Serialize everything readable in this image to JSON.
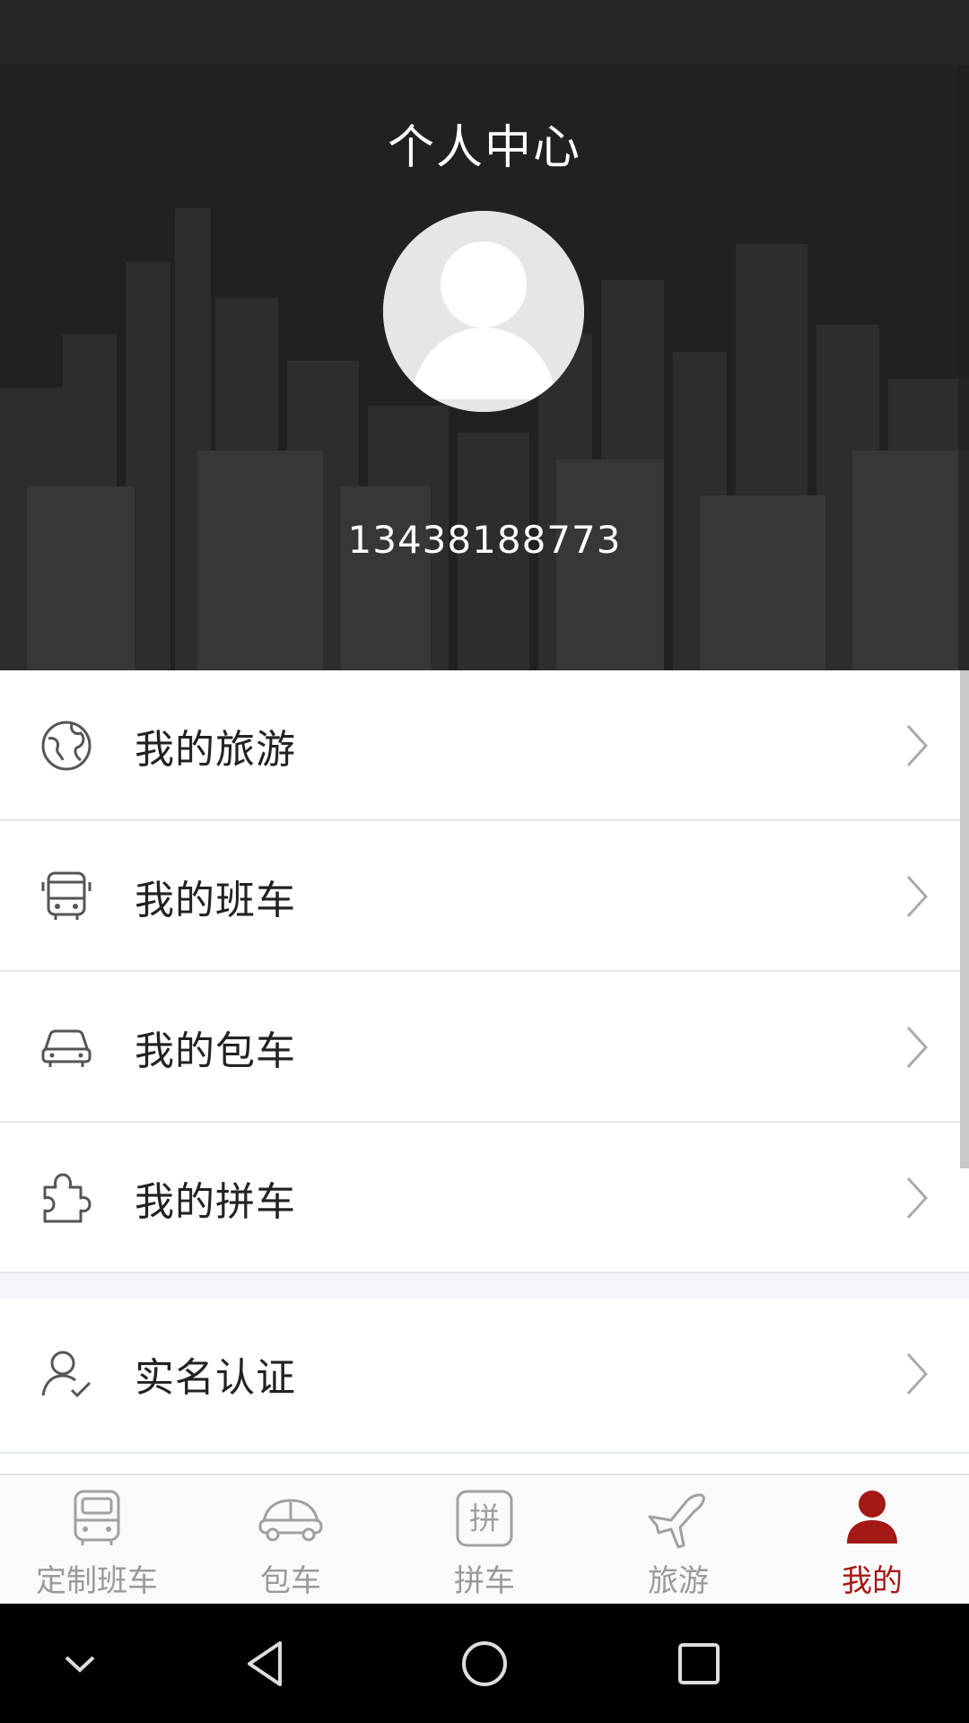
{
  "header": {
    "title": "个人中心",
    "phone": "13438188773"
  },
  "menu": {
    "items": [
      {
        "label": "我的旅游",
        "icon": "globe-icon"
      },
      {
        "label": "我的班车",
        "icon": "bus-icon"
      },
      {
        "label": "我的包车",
        "icon": "car-icon"
      },
      {
        "label": "我的拼车",
        "icon": "puzzle-icon"
      }
    ],
    "verify": {
      "label": "实名认证",
      "icon": "user-check-icon"
    }
  },
  "tabbar": {
    "tabs": [
      {
        "label": "定制班车",
        "icon": "bus-icon",
        "active": false
      },
      {
        "label": "包车",
        "icon": "car-icon",
        "active": false
      },
      {
        "label": "拼车",
        "icon": "pin-icon",
        "icon_text": "拼",
        "active": false
      },
      {
        "label": "旅游",
        "icon": "plane-icon",
        "active": false
      },
      {
        "label": "我的",
        "icon": "user-icon",
        "active": true
      }
    ]
  },
  "colors": {
    "accent": "#a41815",
    "tab_inactive": "#9a9a9a",
    "header_bg": "#2e2e2e"
  }
}
